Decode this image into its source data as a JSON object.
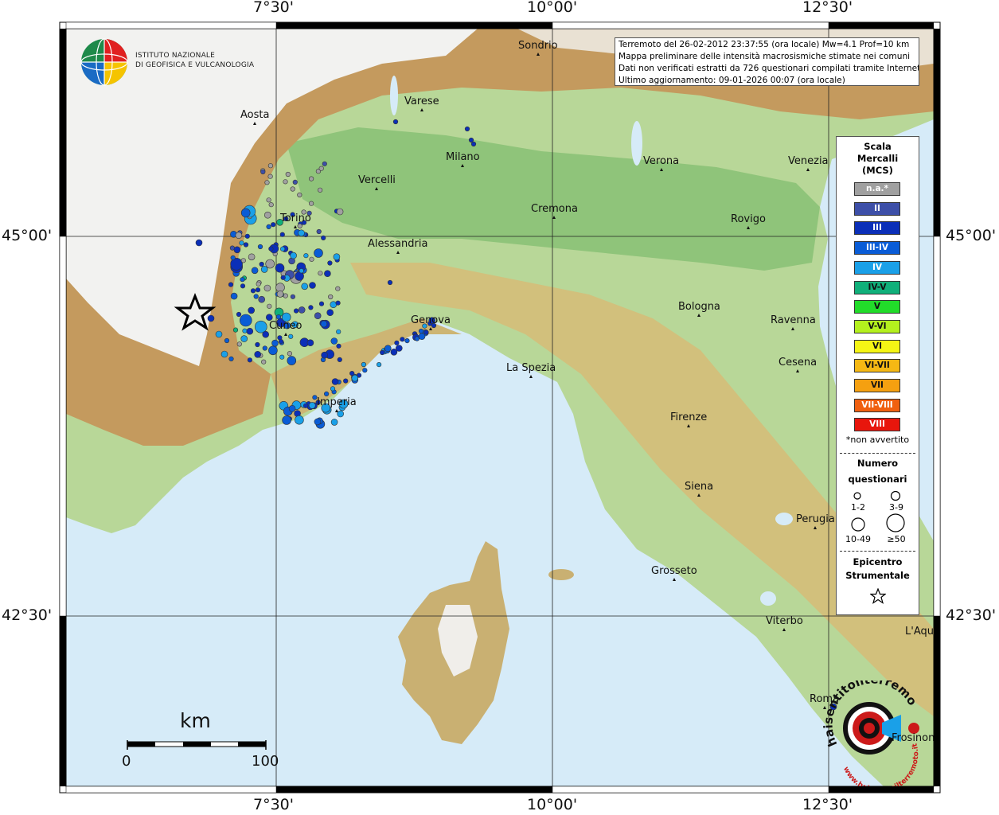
{
  "institute": {
    "line1": "ISTITUTO NAZIONALE",
    "line2": "DI GEOFISICA E VULCANOLOGIA"
  },
  "info": {
    "line1": "Terremoto del 26-02-2012 23:37:55 (ora locale) Mw=4.1 Prof=10 km",
    "line2": "Mappa preliminare delle intensità macrosismiche stimate nei comuni",
    "line3": "Dati non verificati estratti da 726 questionari compilati tramite Internet.",
    "line4": "Ultimo aggiornamento: 09-01-2026 00:07 (ora locale)"
  },
  "coords": {
    "top": [
      "7°30'",
      "10°00'",
      "12°30'"
    ],
    "bottom": [
      "7°30'",
      "10°00'",
      "12°30'"
    ],
    "left": [
      "45°00'",
      "42°30'"
    ],
    "right": [
      "45°00'",
      "42°30'"
    ]
  },
  "cities": [
    {
      "name": "Sondrio"
    },
    {
      "name": "Varese"
    },
    {
      "name": "Aosta"
    },
    {
      "name": "Milano"
    },
    {
      "name": "Verona"
    },
    {
      "name": "Venezia"
    },
    {
      "name": "Vercelli"
    },
    {
      "name": "Torino"
    },
    {
      "name": "Cremona"
    },
    {
      "name": "Rovigo"
    },
    {
      "name": "Alessandria"
    },
    {
      "name": "Bologna"
    },
    {
      "name": "Genova"
    },
    {
      "name": "Cuneo"
    },
    {
      "name": "Ravenna"
    },
    {
      "name": "Cesena"
    },
    {
      "name": "La Spezia"
    },
    {
      "name": "Imperia"
    },
    {
      "name": "Firenze"
    },
    {
      "name": "Siena"
    },
    {
      "name": "Perugia"
    },
    {
      "name": "Grosseto"
    },
    {
      "name": "Viterbo"
    },
    {
      "name": "L'Aquila"
    },
    {
      "name": "Roma"
    },
    {
      "name": "Frosinone"
    }
  ],
  "legend": {
    "title_line1": "Scala",
    "title_line2": "Mercalli",
    "title_line3": "(MCS)",
    "classes": [
      {
        "label": "n.a.*",
        "color": "#a0a0a0",
        "text": "#ffffff"
      },
      {
        "label": "II",
        "color": "#3d4fa8",
        "text": "#ffffff"
      },
      {
        "label": "III",
        "color": "#0b2fb8",
        "text": "#ffffff"
      },
      {
        "label": "III-IV",
        "color": "#0a5cd6",
        "text": "#ffffff"
      },
      {
        "label": "IV",
        "color": "#1aa0e8",
        "text": "#ffffff"
      },
      {
        "label": "IV-V",
        "color": "#10b07a",
        "text": "#111111"
      },
      {
        "label": "V",
        "color": "#22dc2a",
        "text": "#111111"
      },
      {
        "label": "V-VI",
        "color": "#b4f01e",
        "text": "#111111"
      },
      {
        "label": "VI",
        "color": "#f5f515",
        "text": "#111111"
      },
      {
        "label": "VI-VII",
        "color": "#f5b814",
        "text": "#111111"
      },
      {
        "label": "VII",
        "color": "#f5a010",
        "text": "#111111"
      },
      {
        "label": "VII-VIII",
        "color": "#f06010",
        "text": "#ffffff"
      },
      {
        "label": "VIII",
        "color": "#e8160c",
        "text": "#ffffff"
      }
    ],
    "note": "*non avvertito",
    "count_title1": "Numero",
    "count_title2": "questionari",
    "sizes": [
      "1-2",
      "3-9",
      "10-49",
      "≥50"
    ],
    "epicenter_title1": "Epicentro",
    "epicenter_title2": "Strumentale"
  },
  "scalebar": {
    "unit": "km",
    "min": "0",
    "max": "100"
  },
  "logo": {
    "text_main": "haisentitoilterremoto.it",
    "text_sub": "www.haisentitoilterremoto.it"
  },
  "colors": {
    "sea": "#d6ebf8",
    "plain": "#a6cf8c",
    "hills": "#d2c07c",
    "mountains": "#b88a50",
    "snow": "#f4f4f4",
    "border_frame": "#000000"
  }
}
